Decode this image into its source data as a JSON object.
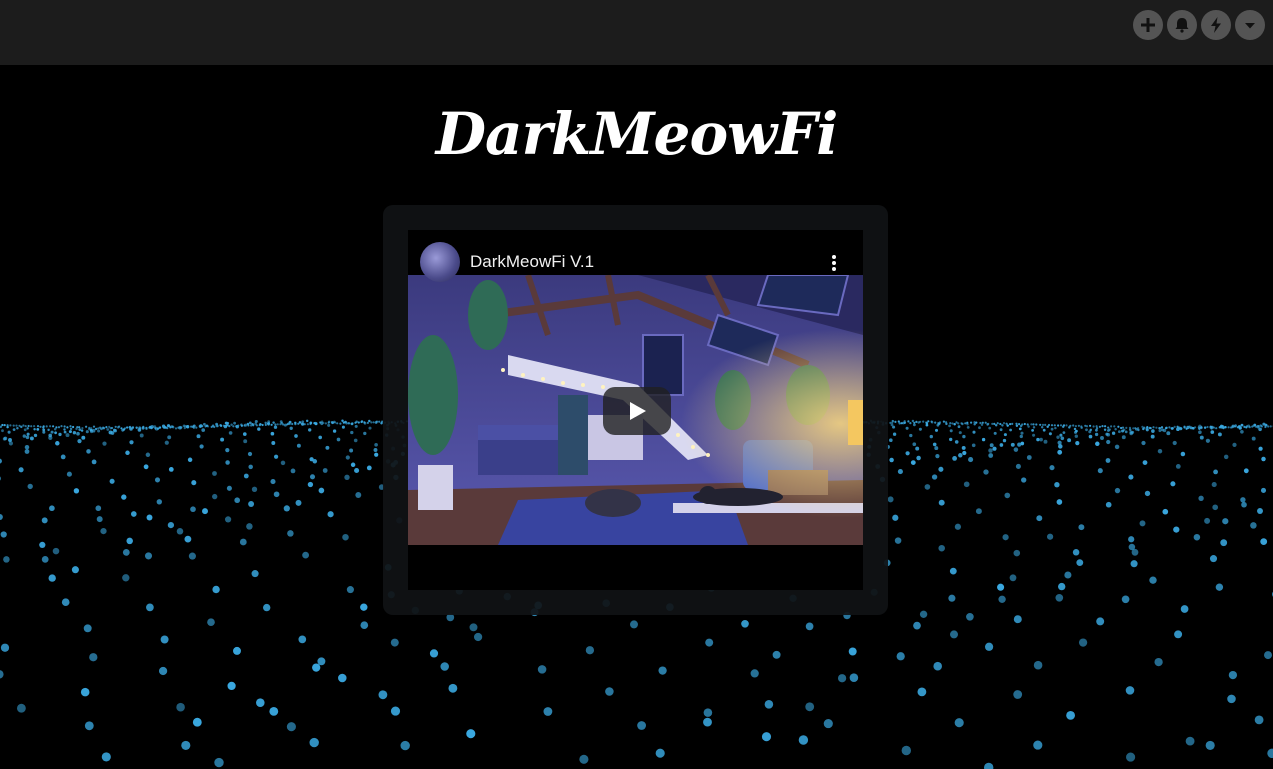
{
  "page": {
    "title": "DarkMeowFi"
  },
  "toolbar": {
    "buttons": [
      {
        "icon": "plus-icon"
      },
      {
        "icon": "bell-icon"
      },
      {
        "icon": "lightning-icon"
      },
      {
        "icon": "caret-down-icon"
      }
    ]
  },
  "video": {
    "title": "DarkMeowFi V.1",
    "channel_avatar": "channel-avatar",
    "play_icon": "play-icon",
    "menu_icon": "more-vertical-icon"
  },
  "colors": {
    "background": "#000000",
    "topbar": "#1c1c1c",
    "particles": "#3aa8e0",
    "card": "#101214",
    "title": "#ffffff"
  }
}
